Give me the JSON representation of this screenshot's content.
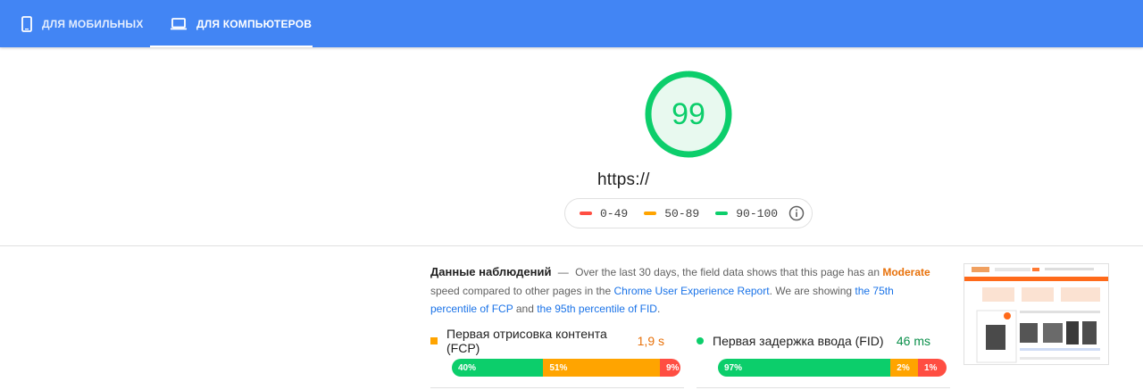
{
  "tabs": [
    {
      "label": "ДЛЯ МОБИЛЬНЫХ",
      "icon": "smartphone-icon",
      "active": false
    },
    {
      "label": "ДЛЯ КОМПЬЮТЕРОВ",
      "icon": "laptop-icon",
      "active": true
    }
  ],
  "colors": {
    "topbar": "#4285f4",
    "fast": "#0cce6b",
    "average": "#ffa400",
    "slow": "#ff4e42",
    "link": "#1a73e8",
    "moderate": "#e8710a"
  },
  "score": {
    "value": "99",
    "fraction": 0.99
  },
  "url": "https://",
  "legend": [
    {
      "range": "0-49",
      "color": "#ff4e42"
    },
    {
      "range": "50-89",
      "color": "#ffa400"
    },
    {
      "range": "90-100",
      "color": "#0cce6b"
    }
  ],
  "field_data": {
    "title": "Данные наблюдений",
    "dash": "—",
    "text1": "Over the last 30 days, the field data shows that this page has an",
    "moderate": "Moderate",
    "text2": "speed compared to other pages in the",
    "link1": "Chrome User Experience Report",
    "text3": ". We are showing",
    "link2": "the 75th percentile of FCP",
    "text4": "and",
    "link3": "the 95th percentile of FID",
    "text5": "."
  },
  "metrics": [
    {
      "label": "Первая отрисовка контента (FCP)",
      "value": "1,9 s",
      "value_color": "#e8710a",
      "marker": "average",
      "distribution": [
        {
          "label": "40%",
          "fraction": 0.4,
          "color": "#0cce6b"
        },
        {
          "label": "51%",
          "fraction": 0.51,
          "color": "#ffa400"
        },
        {
          "label": "9%",
          "fraction": 0.09,
          "color": "#ff4e42"
        }
      ]
    },
    {
      "label": "Первая задержка ввода (FID)",
      "value": "46 ms",
      "value_color": "#0a8f4a",
      "marker": "fast",
      "distribution": [
        {
          "label": "97%",
          "fraction": 0.755,
          "color": "#0cce6b"
        },
        {
          "label": "2%",
          "fraction": 0.12,
          "color": "#ffa400"
        },
        {
          "label": "1%",
          "fraction": 0.125,
          "color": "#ff4e42"
        }
      ]
    }
  ]
}
